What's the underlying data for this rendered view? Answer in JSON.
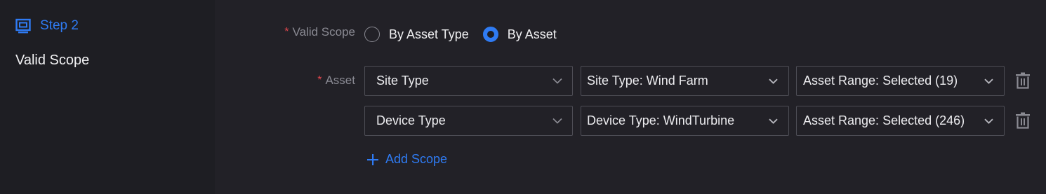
{
  "step": {
    "title": "Step 2",
    "subtitle": "Valid Scope"
  },
  "valid_scope": {
    "label": "Valid Scope",
    "options": [
      {
        "label": "By Asset Type",
        "checked": false
      },
      {
        "label": "By Asset",
        "checked": true
      }
    ]
  },
  "asset": {
    "label": "Asset",
    "rows": [
      {
        "type": "Site Type",
        "filter": "Site Type: Wind Farm",
        "range": "Asset Range: Selected (19)"
      },
      {
        "type": "Device Type",
        "filter": "Device Type: WindTurbine",
        "range": "Asset Range: Selected (246)"
      }
    ]
  },
  "add_scope_label": "Add Scope",
  "colors": {
    "accent": "#2f7bf3",
    "required": "#e0464d",
    "background": "#222127",
    "sidebar": "#1e1e23"
  }
}
